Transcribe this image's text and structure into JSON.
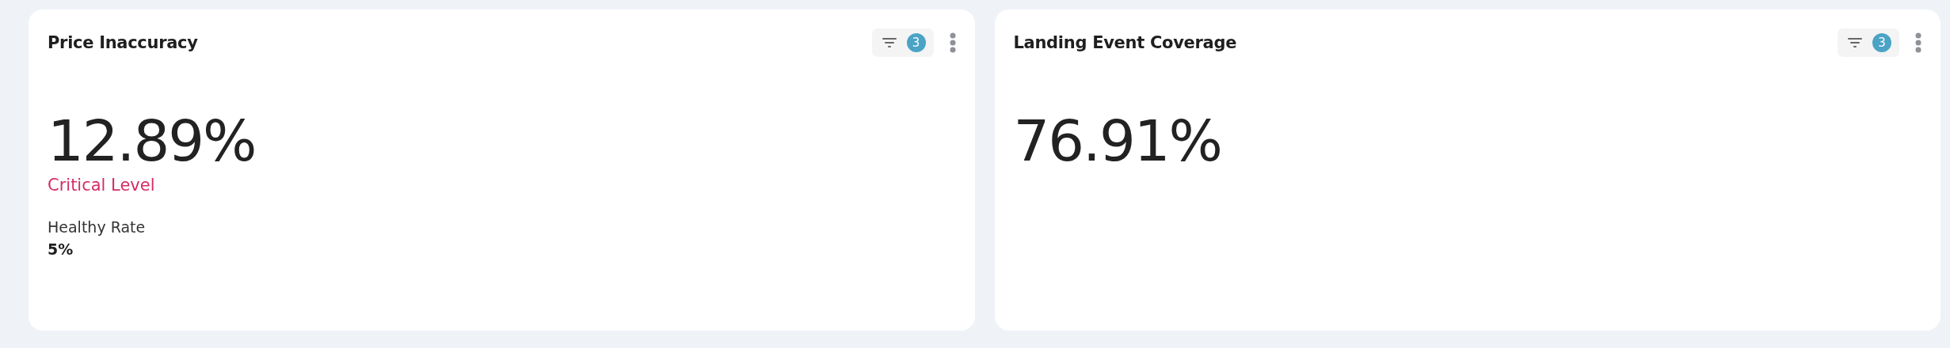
{
  "cards": [
    {
      "title": "Price Inaccuracy",
      "filter_count": "3",
      "value": "12.89%",
      "status": "Critical Level",
      "healthy_rate": {
        "label": "Healthy Rate",
        "value": "5%"
      }
    },
    {
      "title": "Landing Event Coverage",
      "filter_count": "3",
      "value": "76.91%"
    }
  ]
}
